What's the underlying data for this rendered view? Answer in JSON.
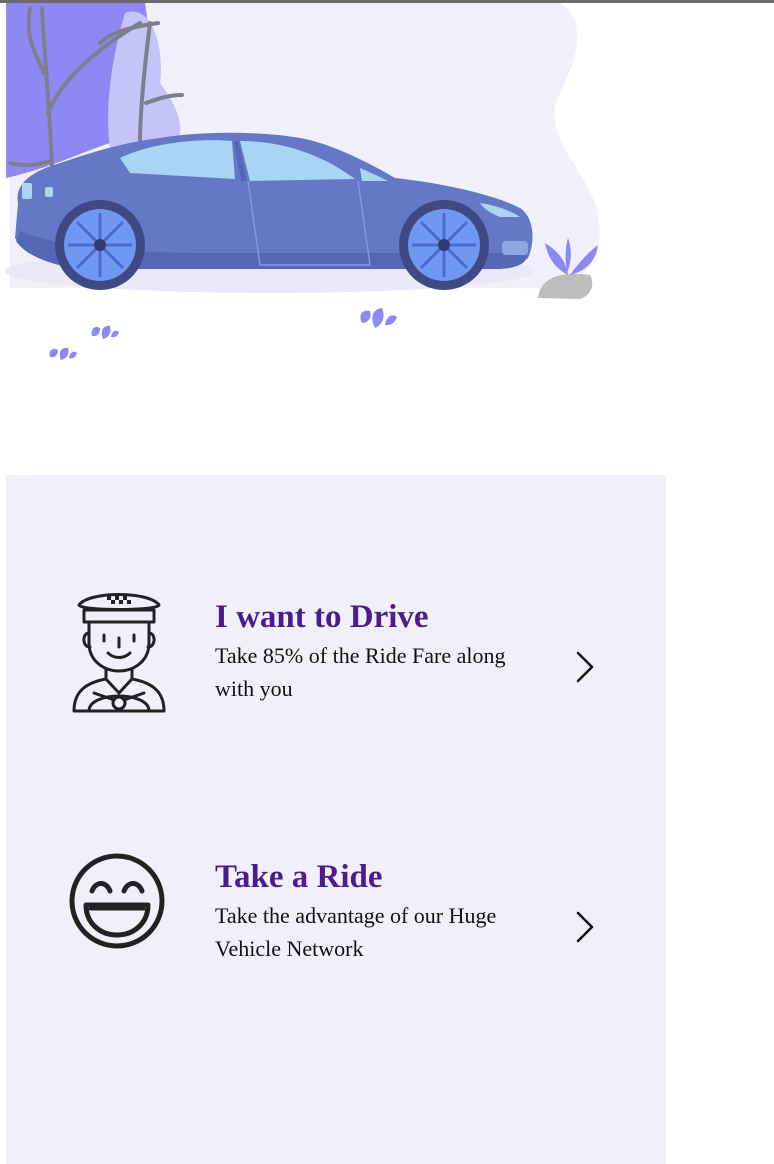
{
  "options": [
    {
      "title": "I want to Drive",
      "description": "Take 85% of the Ride Fare along with you",
      "icon": "taxi-driver-icon"
    },
    {
      "title": "Take a Ride",
      "description": "Take the advantage of our Huge Vehicle Network",
      "icon": "smiley-face-icon"
    }
  ],
  "colors": {
    "panel_background": "#f1f0fa",
    "title": "#4b1d8c",
    "car_body": "#6578c6",
    "car_window": "#a9d4f4",
    "wheel": "#6f98f2",
    "tree": "#8e88f5",
    "blob": "#f1f0fa"
  }
}
